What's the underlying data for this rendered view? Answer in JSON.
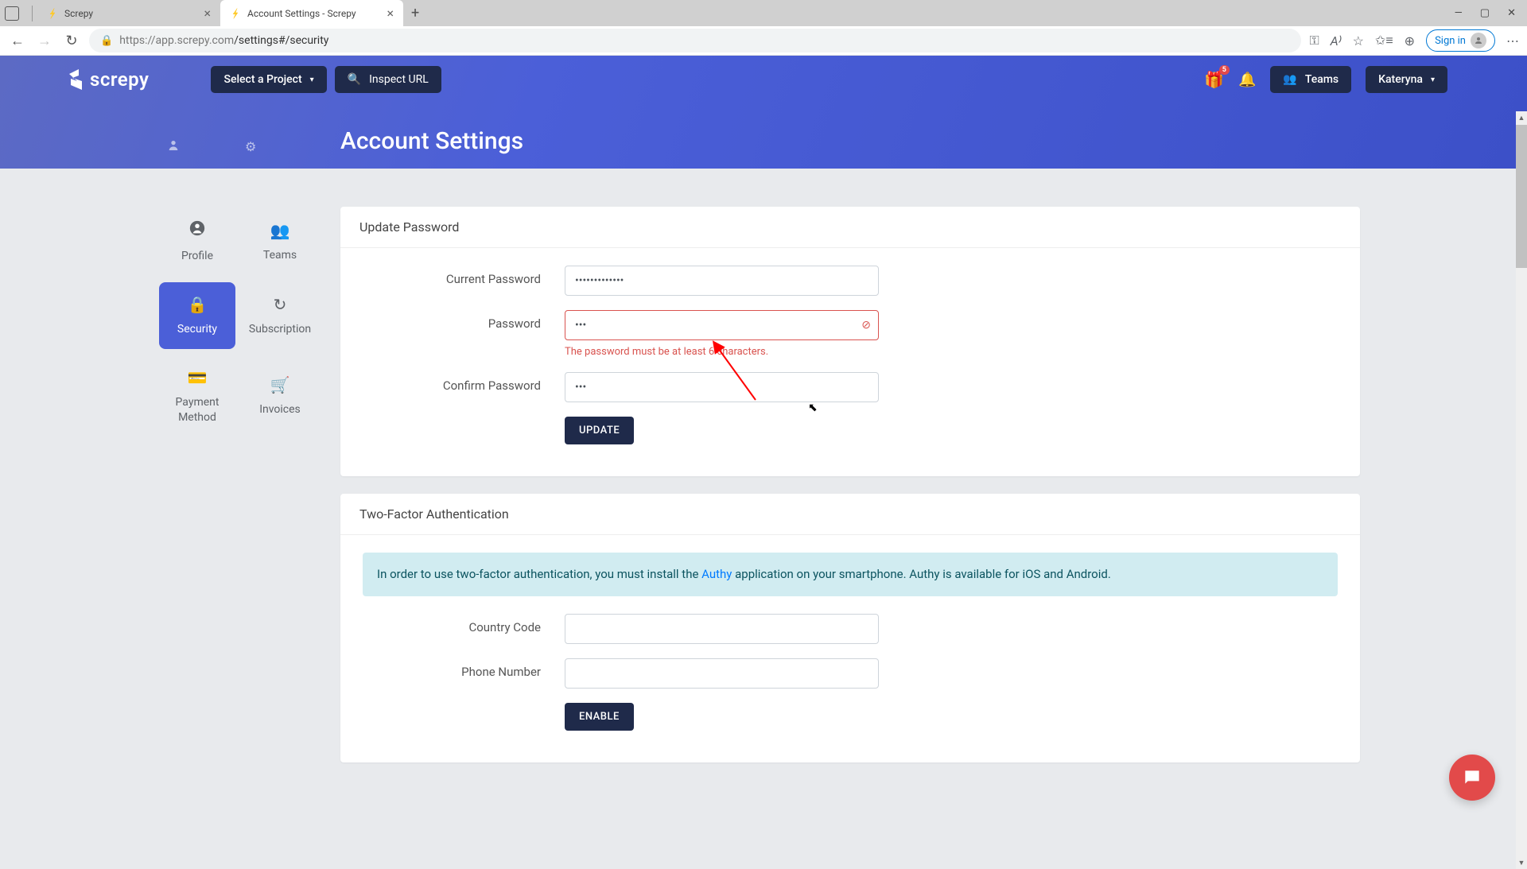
{
  "browser": {
    "tabs": [
      {
        "title": "Screpy",
        "active": false
      },
      {
        "title": "Account Settings - Screpy",
        "active": true
      }
    ],
    "url_host": "https://app.screpy.com",
    "url_path": "/settings#/security",
    "signin_label": "Sign in"
  },
  "app": {
    "logo": "screpy",
    "project_btn": "Select a Project",
    "inspect_placeholder": "Inspect URL",
    "gift_badge": "5",
    "teams_btn": "Teams",
    "user_btn": "Kateryna"
  },
  "page": {
    "title": "Account Settings"
  },
  "sidebar": {
    "items": [
      {
        "label": "Profile"
      },
      {
        "label": "Teams"
      },
      {
        "label": "Security"
      },
      {
        "label": "Subscription"
      },
      {
        "label": "Payment Method"
      },
      {
        "label": "Invoices"
      }
    ],
    "active_index": 2
  },
  "password_card": {
    "title": "Update Password",
    "fields": {
      "current": {
        "label": "Current Password",
        "value": "•••••••••••••"
      },
      "new": {
        "label": "Password",
        "value": "•••",
        "error": "The password must be at least 6 characters."
      },
      "confirm": {
        "label": "Confirm Password",
        "value": "•••"
      }
    },
    "submit": "UPDATE"
  },
  "twofa_card": {
    "title": "Two-Factor Authentication",
    "info_pre": "In order to use two-factor authentication, you must install the ",
    "info_link": "Authy",
    "info_post": " application on your smartphone. Authy is available for iOS and Android.",
    "fields": {
      "country": {
        "label": "Country Code",
        "value": ""
      },
      "phone": {
        "label": "Phone Number",
        "value": ""
      }
    },
    "submit": "ENABLE"
  }
}
